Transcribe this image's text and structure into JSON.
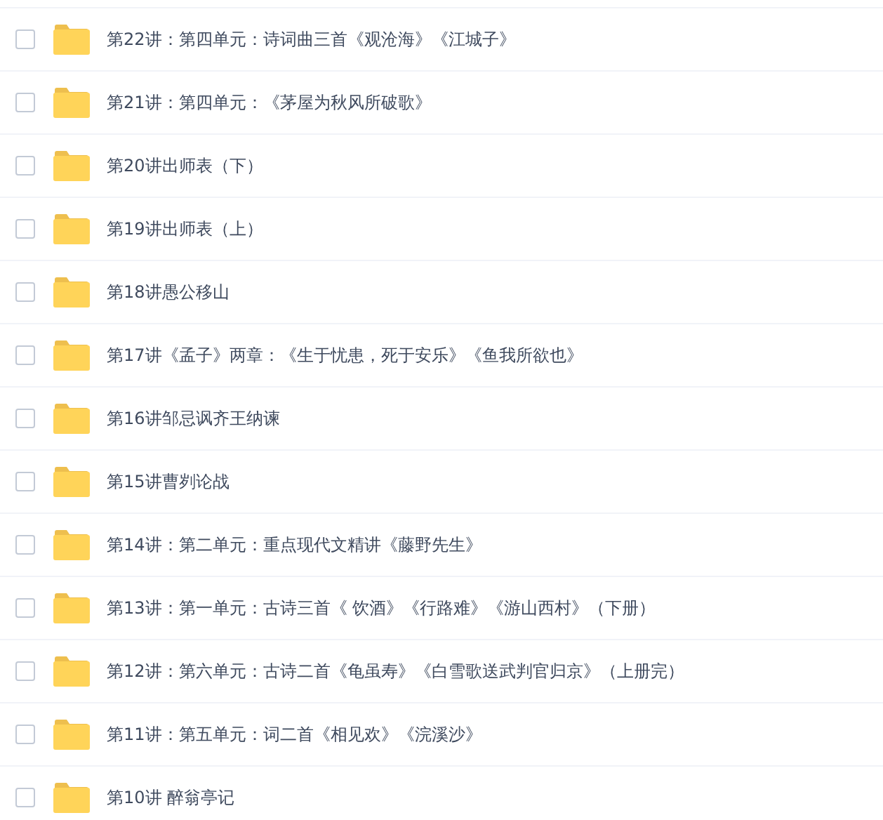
{
  "folders": [
    {
      "name": "第22讲：第四单元：诗词曲三首《观沧海》《江城子》",
      "checked": false
    },
    {
      "name": "第21讲：第四单元：《茅屋为秋风所破歌》",
      "checked": false
    },
    {
      "name": "第20讲出师表（下）",
      "checked": false
    },
    {
      "name": "第19讲出师表（上）",
      "checked": false
    },
    {
      "name": "第18讲愚公移山",
      "checked": false
    },
    {
      "name": "第17讲《孟子》两章：《生于忧患，死于安乐》《鱼我所欲也》",
      "checked": false
    },
    {
      "name": "第16讲邹忌讽齐王纳谏",
      "checked": false
    },
    {
      "name": "第15讲曹刿论战",
      "checked": false
    },
    {
      "name": "第14讲：第二单元：重点现代文精讲《藤野先生》",
      "checked": false
    },
    {
      "name": "第13讲：第一单元：古诗三首《 饮酒》《行路难》《游山西村》（下册）",
      "checked": false
    },
    {
      "name": "第12讲：第六单元：古诗二首《龟虽寿》《白雪歌送武判官归京》（上册完）",
      "checked": false
    },
    {
      "name": "第11讲：第五单元：词二首《相见欢》《浣溪沙》",
      "checked": false
    },
    {
      "name": "第10讲 醉翁亭记",
      "checked": false
    }
  ]
}
